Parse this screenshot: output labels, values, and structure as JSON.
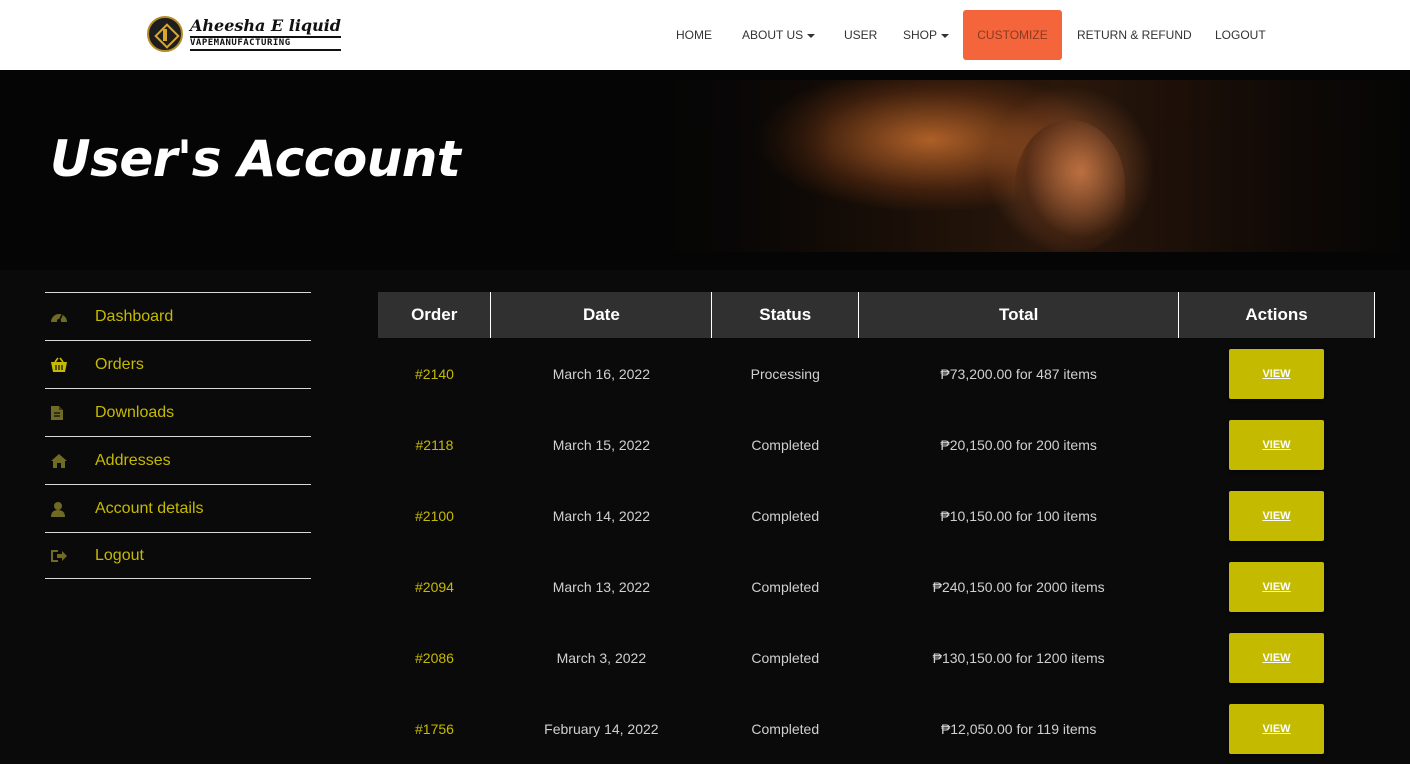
{
  "brand": {
    "name_script": "Aheesha E liquid",
    "name_sub": "VAPEMANUFACTURING"
  },
  "nav": {
    "items": [
      {
        "label": "HOME",
        "has_caret": false
      },
      {
        "label": "ABOUT US",
        "has_caret": true
      },
      {
        "label": "USER",
        "has_caret": false
      },
      {
        "label": "SHOP",
        "has_caret": true
      },
      {
        "label": "CUSTOMIZE",
        "has_caret": false,
        "highlight": true
      },
      {
        "label": "RETURN & REFUND",
        "has_caret": false
      },
      {
        "label": "LOGOUT",
        "has_caret": false
      }
    ]
  },
  "hero": {
    "title": "User's Account"
  },
  "sidebar": {
    "items": [
      {
        "label": "Dashboard",
        "icon": "dashboard-icon"
      },
      {
        "label": "Orders",
        "icon": "basket-icon"
      },
      {
        "label": "Downloads",
        "icon": "file-icon"
      },
      {
        "label": "Addresses",
        "icon": "home-icon"
      },
      {
        "label": "Account details",
        "icon": "user-icon"
      },
      {
        "label": "Logout",
        "icon": "logout-icon"
      }
    ]
  },
  "orders_table": {
    "headers": [
      "Order",
      "Date",
      "Status",
      "Total",
      "Actions"
    ],
    "rows": [
      {
        "order": "#2140",
        "date": "March 16, 2022",
        "status": "Processing",
        "total": "₱73,200.00 for 487 items",
        "action": "VIEW"
      },
      {
        "order": "#2118",
        "date": "March 15, 2022",
        "status": "Completed",
        "total": "₱20,150.00 for 200 items",
        "action": "VIEW"
      },
      {
        "order": "#2100",
        "date": "March 14, 2022",
        "status": "Completed",
        "total": "₱10,150.00 for 100 items",
        "action": "VIEW"
      },
      {
        "order": "#2094",
        "date": "March 13, 2022",
        "status": "Completed",
        "total": "₱240,150.00 for 2000 items",
        "action": "VIEW"
      },
      {
        "order": "#2086",
        "date": "March 3, 2022",
        "status": "Completed",
        "total": "₱130,150.00 for 1200 items",
        "action": "VIEW"
      },
      {
        "order": "#1756",
        "date": "February 14, 2022",
        "status": "Completed",
        "total": "₱12,050.00 for 119 items",
        "action": "VIEW"
      }
    ]
  },
  "colors": {
    "accent": "#c4bb00",
    "customize_bg": "#f4653c",
    "header_cell": "#303030",
    "page_bg": "#0a0a0a"
  }
}
